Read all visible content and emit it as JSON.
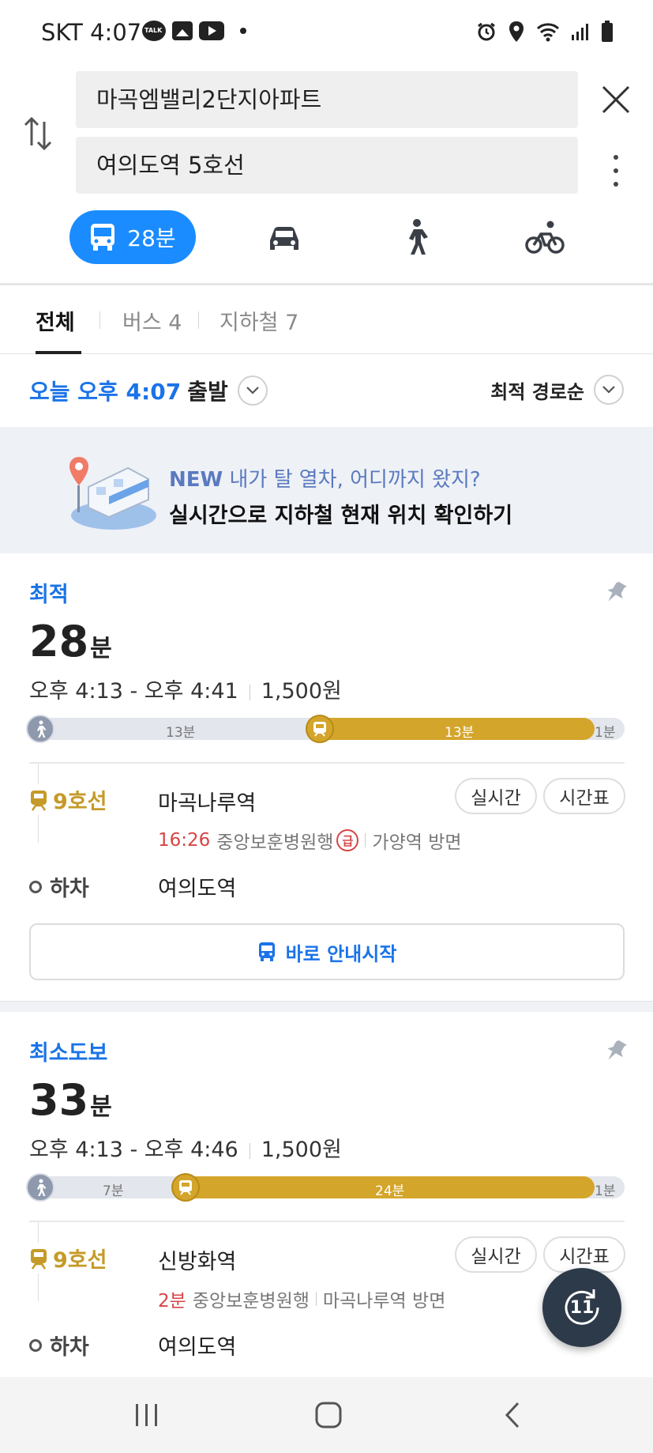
{
  "status_bar": {
    "carrier_time": "SKT 4:07"
  },
  "search": {
    "origin": "마곡엠밸리2단지아파트",
    "destination": "여의도역 5호선"
  },
  "modes": {
    "transit_time": "28분"
  },
  "filter_tabs": [
    {
      "label": "전체"
    },
    {
      "label": "버스 4"
    },
    {
      "label": "지하철 7"
    }
  ],
  "depart": {
    "time": "오늘 오후 4:07",
    "suffix": "출발"
  },
  "sort": {
    "label": "최적 경로순"
  },
  "banner": {
    "new_label": "NEW",
    "line1": "내가 탈 열차, 어디까지 왔지?",
    "line2": "실시간으로 지하철 현재 위치 확인하기"
  },
  "routes": [
    {
      "tag": "최적",
      "duration_value": "28",
      "duration_unit": "분",
      "time_range": "오후 4:13 - 오후 4:41",
      "fare": "1,500원",
      "segments": {
        "walk": "13분",
        "subway": "13분",
        "last_walk": "1분"
      },
      "line": "9호선",
      "board_station": "마곡나루역",
      "realtime_label": "실시간",
      "timetable_label": "시간표",
      "arrival": "16:26",
      "train_dest": "중앙보훈병원행",
      "express_badge": "급",
      "direction": "가양역 방면",
      "alight_label": "하차",
      "alight_station": "여의도역",
      "start_button": "바로 안내시작"
    },
    {
      "tag": "최소도보",
      "duration_value": "33",
      "duration_unit": "분",
      "time_range": "오후 4:13 - 오후 4:46",
      "fare": "1,500원",
      "segments": {
        "walk": "7분",
        "subway": "24분",
        "last_walk": "1분"
      },
      "line": "9호선",
      "board_station": "신방화역",
      "realtime_label": "실시간",
      "timetable_label": "시간표",
      "arrival": "2분",
      "train_dest": "중앙보훈병원행",
      "direction": "마곡나루역 방면",
      "alight_label": "하차",
      "alight_station": "여의도역"
    }
  ],
  "fab": {
    "label": "11"
  },
  "colors": {
    "accent": "#1a8cff",
    "line9": "#d4a52b",
    "red": "#d64545",
    "banner_bg": "#eef1f6"
  }
}
